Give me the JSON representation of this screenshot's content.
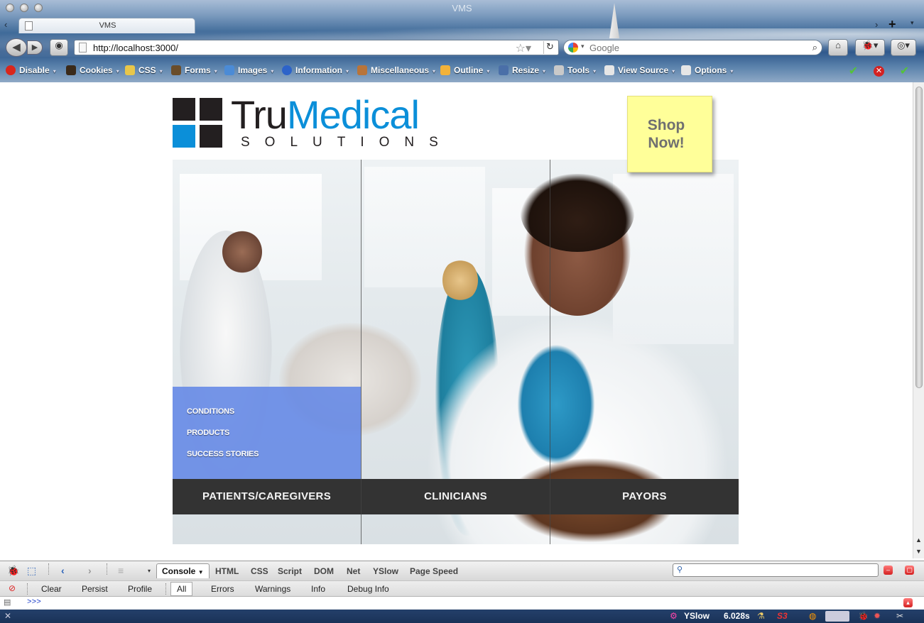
{
  "window": {
    "title": "VMS"
  },
  "tab": {
    "title": "VMS"
  },
  "nav": {
    "url": "http://localhost:3000/",
    "search_placeholder": "Google"
  },
  "webdev_toolbar": {
    "items": [
      {
        "label": "Disable",
        "icon": "disable-icon",
        "color": "#d9261c"
      },
      {
        "label": "Cookies",
        "icon": "cookies-icon",
        "color": "#3a2a1a"
      },
      {
        "label": "CSS",
        "icon": "css-icon",
        "color": "#e8c64a"
      },
      {
        "label": "Forms",
        "icon": "forms-icon",
        "color": "#6a4d2a"
      },
      {
        "label": "Images",
        "icon": "images-icon",
        "color": "#4b8bd6"
      },
      {
        "label": "Information",
        "icon": "information-icon",
        "color": "#2d63c9"
      },
      {
        "label": "Miscellaneous",
        "icon": "miscellaneous-icon",
        "color": "#b8743a"
      },
      {
        "label": "Outline",
        "icon": "outline-icon",
        "color": "#f2b23a"
      },
      {
        "label": "Resize",
        "icon": "resize-icon",
        "color": "#4a6fa8"
      },
      {
        "label": "Tools",
        "icon": "tools-icon",
        "color": "#c9c9c9"
      },
      {
        "label": "View Source",
        "icon": "view-source-icon",
        "color": "#e6e6e6"
      },
      {
        "label": "Options",
        "icon": "options-icon",
        "color": "#e6e6e6"
      }
    ]
  },
  "page": {
    "logo": {
      "word1": "Tru",
      "word2": "Medical",
      "sub": "SOLUTIONS",
      "blue": "#0b8fd9",
      "dark": "#231f20"
    },
    "shop_now": "Shop\nNow!",
    "subnav": [
      "CONDITIONS",
      "PRODUCTS",
      "SUCCESS STORIES"
    ],
    "categories": [
      "PATIENTS/CAREGIVERS",
      "CLINICIANS",
      "PAYORS"
    ]
  },
  "firebug": {
    "tabs": [
      "Console",
      "HTML",
      "CSS",
      "Script",
      "DOM",
      "Net",
      "YSlow",
      "Page Speed"
    ],
    "console_actions": [
      "Clear",
      "Persist",
      "Profile"
    ],
    "filters": [
      "All",
      "Errors",
      "Warnings",
      "Info",
      "Debug Info"
    ],
    "prompt": ">>>"
  },
  "statusbar": {
    "yslow_label": "YSlow",
    "load_time": "6.028s"
  }
}
